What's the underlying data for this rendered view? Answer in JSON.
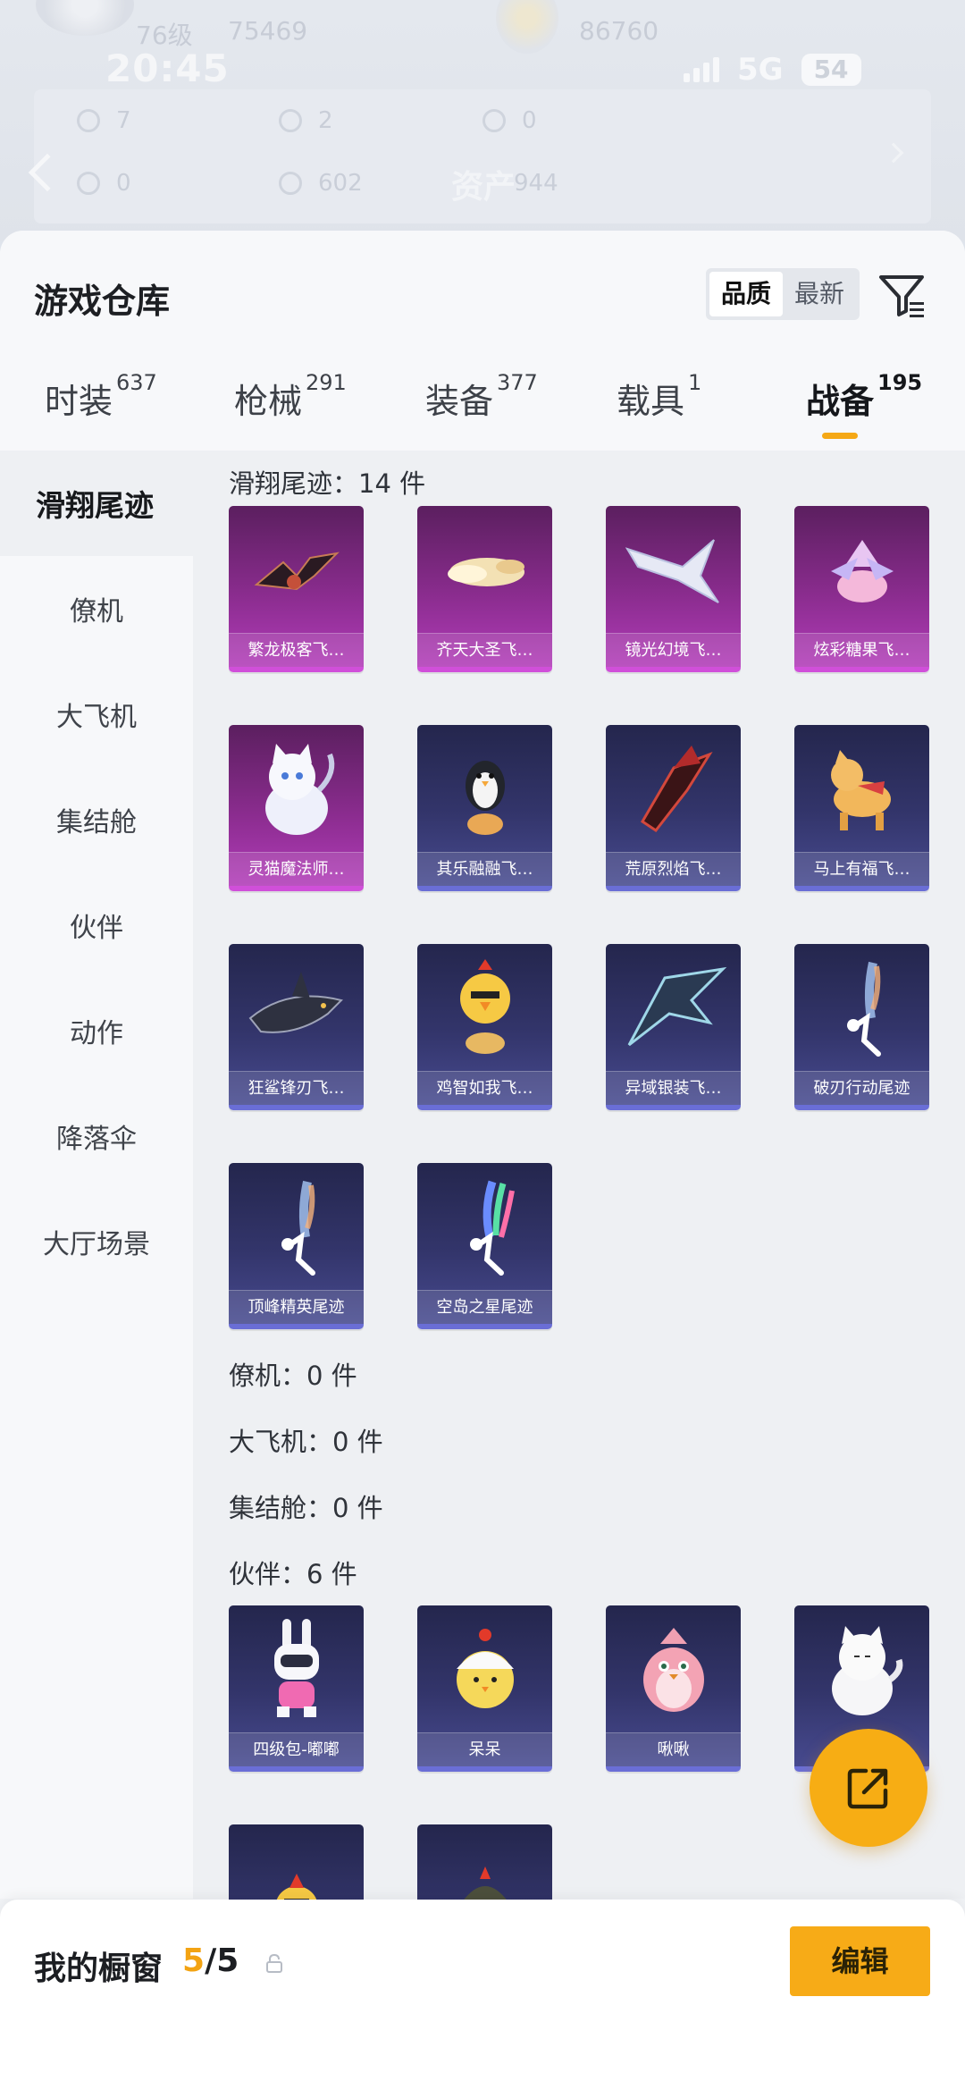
{
  "background_header": {
    "level_text": "76级",
    "coins_text": "75469",
    "score_text": "86760",
    "stats_row1": [
      "7",
      "2",
      "0"
    ],
    "stats_row2": [
      "0",
      "602",
      "944"
    ],
    "assets_title": "资产"
  },
  "status_bar": {
    "time": "20:45",
    "network": "5G",
    "battery": "54"
  },
  "sheet": {
    "title": "游戏仓库",
    "sort_options": [
      "品质",
      "最新"
    ],
    "sort_active": "品质"
  },
  "tabs": [
    {
      "label": "时装",
      "count": "637"
    },
    {
      "label": "枪械",
      "count": "291"
    },
    {
      "label": "装备",
      "count": "377"
    },
    {
      "label": "载具",
      "count": "1"
    },
    {
      "label": "战备",
      "count": "195"
    }
  ],
  "active_tab": "战备",
  "sidebar": [
    "滑翔尾迹",
    "僚机",
    "大飞机",
    "集结舱",
    "伙伴",
    "动作",
    "降落伞",
    "大厅场景"
  ],
  "sections": {
    "glide_trail": {
      "label": "滑翔尾迹：14 件",
      "items": [
        {
          "name": "繁龙极客飞…",
          "rarity": "purple",
          "icon": "bat-wing-glider-icon"
        },
        {
          "name": "齐天大圣飞…",
          "rarity": "purple",
          "icon": "cloud-glider-icon"
        },
        {
          "name": "镜光幻境飞…",
          "rarity": "purple",
          "icon": "crystal-wing-glider-icon"
        },
        {
          "name": "炫彩糖果飞…",
          "rarity": "purple",
          "icon": "candy-glider-icon"
        },
        {
          "name": "灵猫魔法师…",
          "rarity": "purple",
          "icon": "magic-cat-icon"
        },
        {
          "name": "其乐融融飞…",
          "rarity": "blue",
          "icon": "penguin-glider-icon"
        },
        {
          "name": "荒原烈焰飞…",
          "rarity": "blue",
          "icon": "flame-glider-icon"
        },
        {
          "name": "马上有福飞…",
          "rarity": "blue",
          "icon": "horse-toy-icon"
        },
        {
          "name": "狂鲨锋刃飞…",
          "rarity": "blue",
          "icon": "shark-glider-icon"
        },
        {
          "name": "鸡智如我飞…",
          "rarity": "blue",
          "icon": "chick-glider-icon"
        },
        {
          "name": "异域银装飞…",
          "rarity": "blue",
          "icon": "silver-wing-glider-icon"
        },
        {
          "name": "破刃行动尾迹",
          "rarity": "blue",
          "icon": "smoke-trail-icon"
        },
        {
          "name": "顶峰精英尾迹",
          "rarity": "blue",
          "icon": "smoke-trail-icon"
        },
        {
          "name": "空岛之星尾迹",
          "rarity": "blue",
          "icon": "rainbow-trail-icon"
        }
      ]
    },
    "wingman": {
      "label": "僚机：0 件"
    },
    "big_plane": {
      "label": "大飞机：0 件"
    },
    "assembly_pod": {
      "label": "集结舱：0 件"
    },
    "partner": {
      "label": "伙伴：6 件",
      "items": [
        {
          "name": "四级包-嘟嘟",
          "rarity": "blue",
          "icon": "bunny-robot-icon"
        },
        {
          "name": "呆呆",
          "rarity": "blue",
          "icon": "egg-chick-icon"
        },
        {
          "name": "啾啾",
          "rarity": "blue",
          "icon": "pink-bird-icon"
        },
        {
          "name": "",
          "rarity": "blue",
          "icon": "white-cat-icon"
        },
        {
          "name": "",
          "rarity": "blue",
          "icon": "chicken-icon"
        },
        {
          "name": "",
          "rarity": "blue",
          "icon": "helmet-chicken-icon"
        }
      ]
    }
  },
  "bottom": {
    "showcase_label": "我的橱窗",
    "showcase_current": "5",
    "showcase_total": "/5",
    "edit_label": "编辑"
  },
  "colors": {
    "accent": "#f7ab17",
    "purple_rarity": "#b13cb8",
    "blue_rarity": "#474a8f"
  }
}
